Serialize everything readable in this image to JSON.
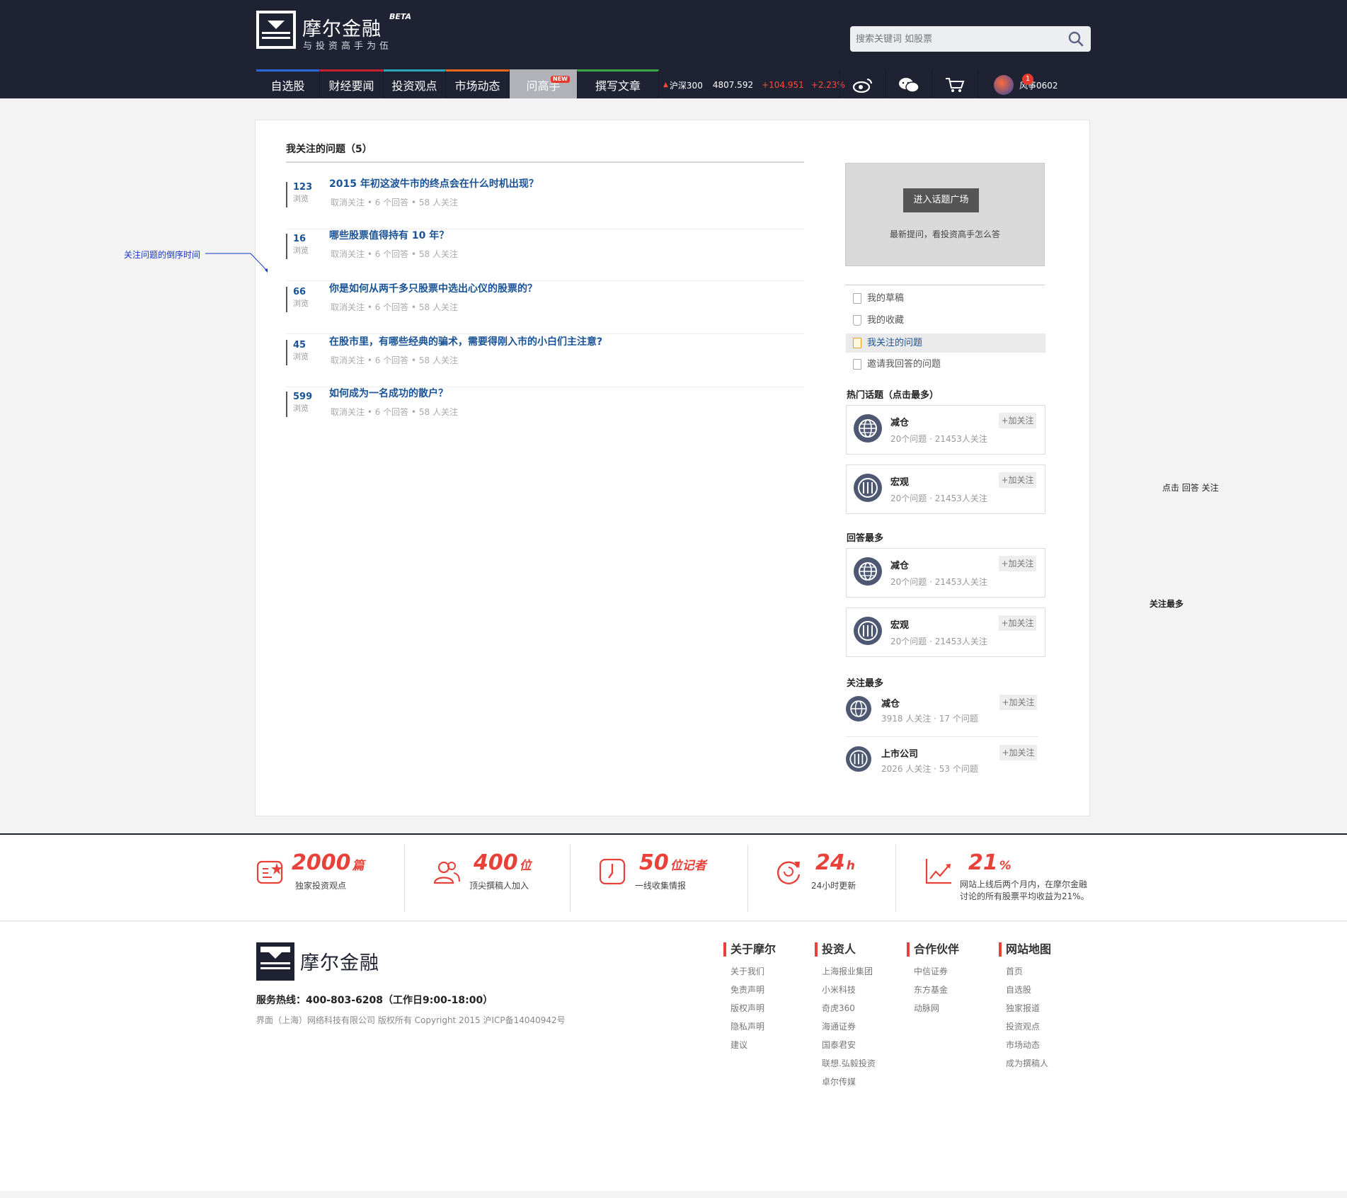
{
  "header": {
    "logo_name": "摩尔金融",
    "logo_beta": "BETA",
    "slogan": "与投资高手为伍",
    "search_placeholder": "搜索关键词 如股票",
    "nav": [
      {
        "label": "自选股",
        "color": "#2a6ad8"
      },
      {
        "label": "财经要闻",
        "color": "#c8232c"
      },
      {
        "label": "投资观点",
        "color": "#2aa8b8"
      },
      {
        "label": "市场动态",
        "color": "#e86a1a"
      },
      {
        "label": "问高手",
        "color": "#b0b2b8",
        "badge": "NEW"
      },
      {
        "label": "撰写文章",
        "color": "#3aa848"
      }
    ],
    "ticker": {
      "name": "沪深300",
      "value": "4807.592",
      "change": "+104.951",
      "pct": "+2.23%"
    },
    "icons": [
      "weibo-icon",
      "wechat-icon",
      "cart-icon"
    ],
    "user": {
      "name": "风筝0602",
      "badge": "1"
    }
  },
  "main": {
    "title": "我关注的问题（5）",
    "annotation": "关注问题的倒序时间",
    "questions": [
      {
        "count": "123",
        "unit": "浏览",
        "text": "2015 年初这波牛市的终点会在什么时机出现？",
        "meta": "取消关注  • 6 个回答  • 58 人关注"
      },
      {
        "count": "16",
        "unit": "浏览",
        "text": "哪些股票值得持有 10 年？",
        "meta": "取消关注  • 6 个回答  • 58 人关注"
      },
      {
        "count": "66",
        "unit": "浏览",
        "text": "你是如何从两千多只股票中选出心仪的股票的？",
        "meta": "取消关注  • 6 个回答  • 58 人关注"
      },
      {
        "count": "45",
        "unit": "浏览",
        "text": "在股市里，有哪些经典的骗术，需要得刚入市的小白们主注意?",
        "meta": "取消关注  • 6 个回答  • 58 人关注"
      },
      {
        "count": "599",
        "unit": "浏览",
        "text": "如何成为一名成功的散户？",
        "meta": "取消关注  • 6 个回答  • 58 人关注"
      }
    ]
  },
  "sidebar": {
    "plaza_button": "进入话题广场",
    "plaza_desc": "最新提问，看投资高手怎么答",
    "menu": [
      "我的草稿",
      "我的收藏",
      "我关注的问题",
      "邀请我回答的问题"
    ],
    "hot_title": "热门话题（点击最多）",
    "hot": [
      {
        "name": "减仓",
        "meta": "20个问题 · 21453人关注",
        "follow": "+加关注"
      },
      {
        "name": "宏观",
        "meta": "20个问题 · 21453人关注",
        "follow": "+加关注"
      }
    ],
    "answer_title": "回答最多",
    "answer": [
      {
        "name": "减仓",
        "meta": "20个问题 · 21453人关注",
        "follow": "+加关注"
      },
      {
        "name": "宏观",
        "meta": "20个问题 · 21453人关注",
        "follow": "+加关注"
      }
    ],
    "follow_title": "关注最多",
    "follow": [
      {
        "name": "减仓",
        "meta": "3918 人关注 · 17 个问题",
        "follow": "+加关注"
      },
      {
        "name": "上市公司",
        "meta": "2026 人关注 · 53 个问题",
        "follow": "+加关注"
      }
    ],
    "note_hot": "点击  回答  关注",
    "note_follow": "关注最多"
  },
  "stats": [
    {
      "num": "2000",
      "unit": "篇",
      "label": "独家投资观点"
    },
    {
      "num": "400",
      "unit": "位",
      "label": "顶尖撰稿人加入"
    },
    {
      "num": "50",
      "unit": "位记者",
      "label": "一线收集情报"
    },
    {
      "num": "24",
      "unit": "h",
      "label": "24小时更新"
    },
    {
      "num": "21",
      "unit": "%",
      "label": "网站上线后两个月内，在摩尔金融",
      "label2": "讨论的所有股票平均收益为21%。"
    }
  ],
  "footer": {
    "logo_name": "摩尔金融",
    "hotline": "服务热线：400-803-6208（工作日9:00-18:00）",
    "copyright": "界面（上海）网络科技有限公司 版权所有 Copyright 2015 沪ICP备14040942号",
    "cols": [
      {
        "title": "关于摩尔",
        "links": [
          "关于我们",
          "免责声明",
          "版权声明",
          "隐私声明",
          "建议"
        ]
      },
      {
        "title": "投资人",
        "links": [
          "上海报业集团",
          "小米科技",
          "奇虎360",
          "海通证券",
          "国泰君安",
          "联想.弘毅投资",
          "卓尔传媒"
        ]
      },
      {
        "title": "合作伙伴",
        "links": [
          "中信证券",
          "东方基金",
          "动脉网"
        ]
      },
      {
        "title": "网站地图",
        "links": [
          "首页",
          "自选股",
          "独家报道",
          "投资观点",
          "市场动态",
          "成为撰稿人"
        ]
      }
    ]
  }
}
